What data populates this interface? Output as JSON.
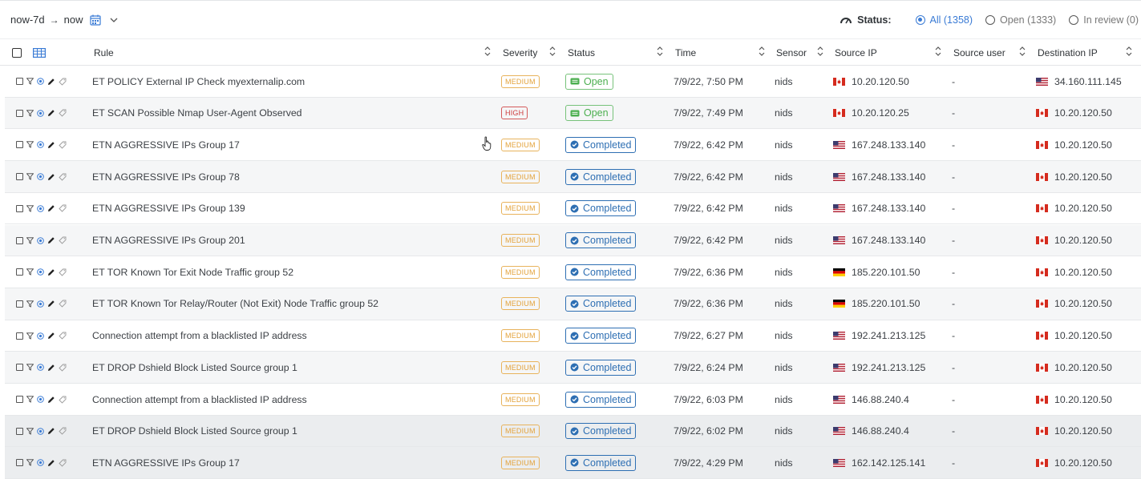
{
  "range": {
    "from": "now-7d",
    "to": "now"
  },
  "status_filter": {
    "label": "Status:",
    "options": [
      {
        "label": "All (1358)",
        "selected": true
      },
      {
        "label": "Open (1333)",
        "selected": false
      },
      {
        "label": "In review (0)",
        "selected": false
      }
    ]
  },
  "columns": {
    "rule": "Rule",
    "severity": "Severity",
    "status": "Status",
    "time": "Time",
    "sensor": "Sensor",
    "source_ip": "Source IP",
    "source_user": "Source user",
    "destination_ip": "Destination IP"
  },
  "colors": {
    "accent": "#3a7bd5",
    "medium": "#e3a23a",
    "high": "#cc3b3b",
    "open": "#4caf50",
    "completed": "#2e6fb3"
  },
  "rows": [
    {
      "rule": "ET POLICY External IP Check myexternalip.com",
      "severity": "MEDIUM",
      "status": "Open",
      "time": "7/9/22, 7:50 PM",
      "sensor": "nids",
      "src_flag": "ca",
      "src_ip": "10.20.120.50",
      "src_user": "-",
      "dst_flag": "us",
      "dst_ip": "34.160.111.145"
    },
    {
      "rule": "ET SCAN Possible Nmap User-Agent Observed",
      "severity": "HIGH",
      "status": "Open",
      "time": "7/9/22, 7:49 PM",
      "sensor": "nids",
      "src_flag": "ca",
      "src_ip": "10.20.120.25",
      "src_user": "-",
      "dst_flag": "ca",
      "dst_ip": "10.20.120.50"
    },
    {
      "rule": "ETN AGGRESSIVE IPs Group 17",
      "severity": "MEDIUM",
      "status": "Completed",
      "time": "7/9/22, 6:42 PM",
      "sensor": "nids",
      "src_flag": "us",
      "src_ip": "167.248.133.140",
      "src_user": "-",
      "dst_flag": "ca",
      "dst_ip": "10.20.120.50"
    },
    {
      "rule": "ETN AGGRESSIVE IPs Group 78",
      "severity": "MEDIUM",
      "status": "Completed",
      "time": "7/9/22, 6:42 PM",
      "sensor": "nids",
      "src_flag": "us",
      "src_ip": "167.248.133.140",
      "src_user": "-",
      "dst_flag": "ca",
      "dst_ip": "10.20.120.50"
    },
    {
      "rule": "ETN AGGRESSIVE IPs Group 139",
      "severity": "MEDIUM",
      "status": "Completed",
      "time": "7/9/22, 6:42 PM",
      "sensor": "nids",
      "src_flag": "us",
      "src_ip": "167.248.133.140",
      "src_user": "-",
      "dst_flag": "ca",
      "dst_ip": "10.20.120.50"
    },
    {
      "rule": "ETN AGGRESSIVE IPs Group 201",
      "severity": "MEDIUM",
      "status": "Completed",
      "time": "7/9/22, 6:42 PM",
      "sensor": "nids",
      "src_flag": "us",
      "src_ip": "167.248.133.140",
      "src_user": "-",
      "dst_flag": "ca",
      "dst_ip": "10.20.120.50"
    },
    {
      "rule": "ET TOR Known Tor Exit Node Traffic group 52",
      "severity": "MEDIUM",
      "status": "Completed",
      "time": "7/9/22, 6:36 PM",
      "sensor": "nids",
      "src_flag": "de",
      "src_ip": "185.220.101.50",
      "src_user": "-",
      "dst_flag": "ca",
      "dst_ip": "10.20.120.50"
    },
    {
      "rule": "ET TOR Known Tor Relay/Router (Not Exit) Node Traffic group 52",
      "severity": "MEDIUM",
      "status": "Completed",
      "time": "7/9/22, 6:36 PM",
      "sensor": "nids",
      "src_flag": "de",
      "src_ip": "185.220.101.50",
      "src_user": "-",
      "dst_flag": "ca",
      "dst_ip": "10.20.120.50"
    },
    {
      "rule": "Connection attempt from a blacklisted IP address",
      "severity": "MEDIUM",
      "status": "Completed",
      "time": "7/9/22, 6:27 PM",
      "sensor": "nids",
      "src_flag": "us",
      "src_ip": "192.241.213.125",
      "src_user": "-",
      "dst_flag": "ca",
      "dst_ip": "10.20.120.50"
    },
    {
      "rule": "ET DROP Dshield Block Listed Source group 1",
      "severity": "MEDIUM",
      "status": "Completed",
      "time": "7/9/22, 6:24 PM",
      "sensor": "nids",
      "src_flag": "us",
      "src_ip": "192.241.213.125",
      "src_user": "-",
      "dst_flag": "ca",
      "dst_ip": "10.20.120.50"
    },
    {
      "rule": "Connection attempt from a blacklisted IP address",
      "severity": "MEDIUM",
      "status": "Completed",
      "time": "7/9/22, 6:03 PM",
      "sensor": "nids",
      "src_flag": "us",
      "src_ip": "146.88.240.4",
      "src_user": "-",
      "dst_flag": "ca",
      "dst_ip": "10.20.120.50"
    },
    {
      "rule": "ET DROP Dshield Block Listed Source group 1",
      "severity": "MEDIUM",
      "status": "Completed",
      "time": "7/9/22, 6:02 PM",
      "sensor": "nids",
      "src_flag": "us",
      "src_ip": "146.88.240.4",
      "src_user": "-",
      "dst_flag": "ca",
      "dst_ip": "10.20.120.50"
    },
    {
      "rule": "ETN AGGRESSIVE IPs Group 17",
      "severity": "MEDIUM",
      "status": "Completed",
      "time": "7/9/22, 4:29 PM",
      "sensor": "nids",
      "src_flag": "us",
      "src_ip": "162.142.125.141",
      "src_user": "-",
      "dst_flag": "ca",
      "dst_ip": "10.20.120.50"
    }
  ]
}
